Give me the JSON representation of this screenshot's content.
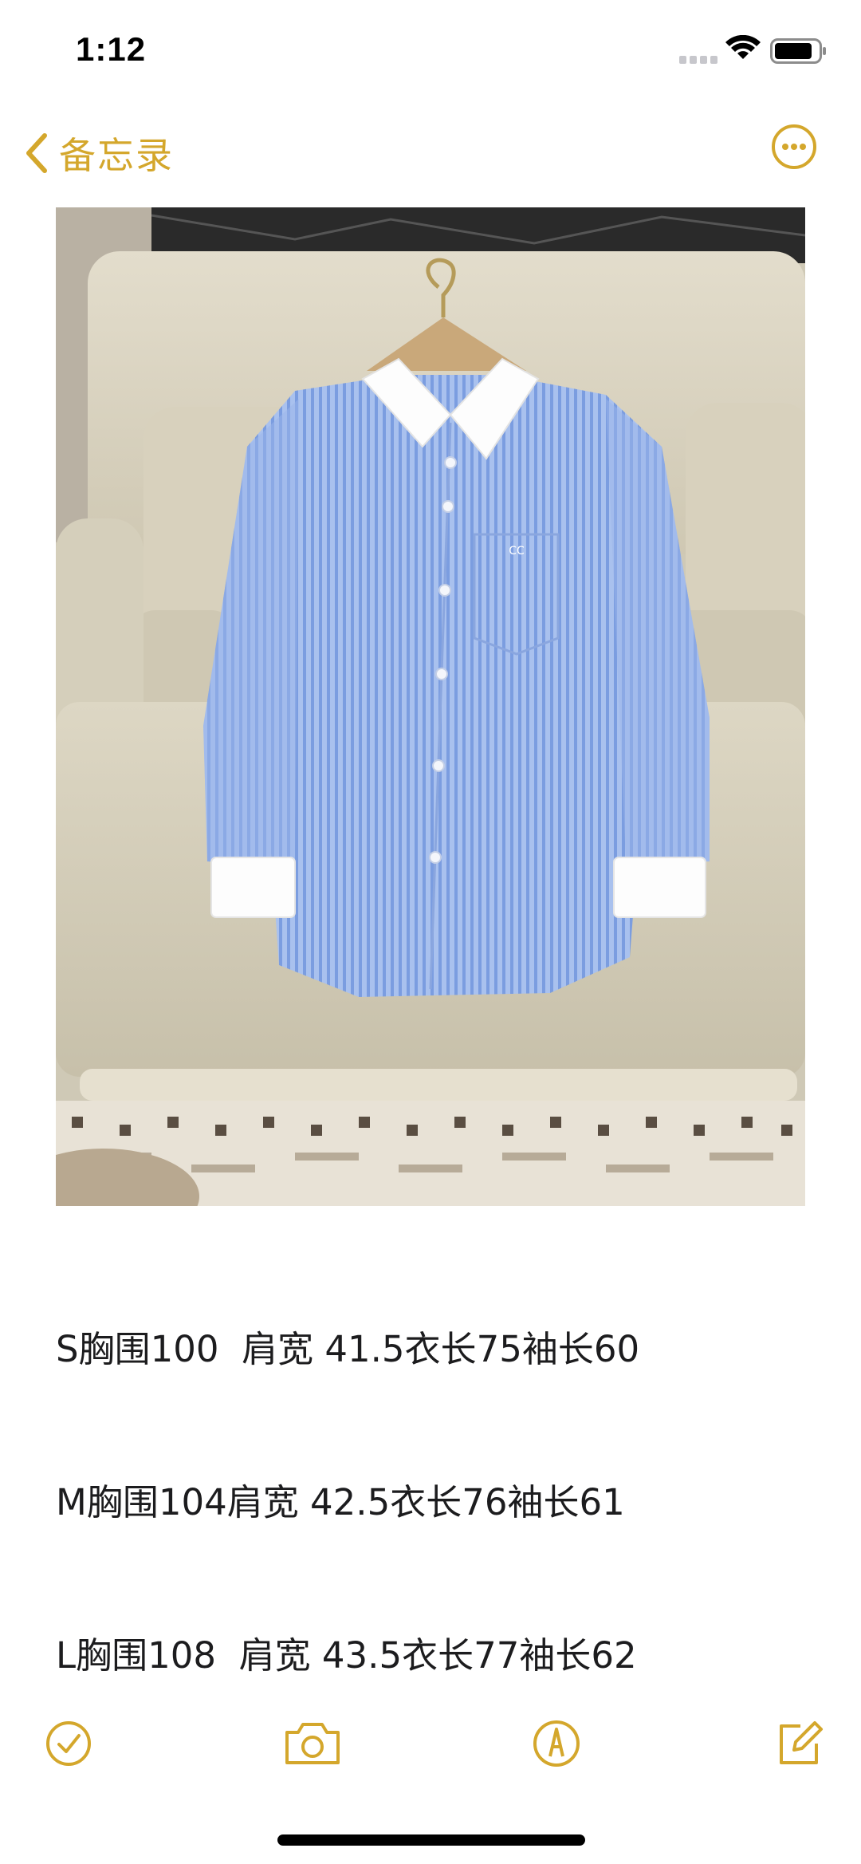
{
  "status_bar": {
    "time": "1:12"
  },
  "nav": {
    "back_label": "备忘录",
    "back_icon": "chevron-left-icon",
    "more_icon": "ellipsis-circle-icon"
  },
  "note": {
    "image_alt_icon": "shirt-photo",
    "lines": [
      "S胸围100  肩宽 41.5衣长75袖长60",
      "M胸围104肩宽 42.5衣长76袖长61",
      "L胸围108  肩宽 43.5衣长77袖长62"
    ]
  },
  "toolbar": {
    "checklist_icon": "checklist-icon",
    "camera_icon": "camera-icon",
    "markup_icon": "markup-pen-icon",
    "compose_icon": "compose-icon"
  },
  "colors": {
    "accent": "#D4A72C",
    "text": "#1c1c1e"
  }
}
